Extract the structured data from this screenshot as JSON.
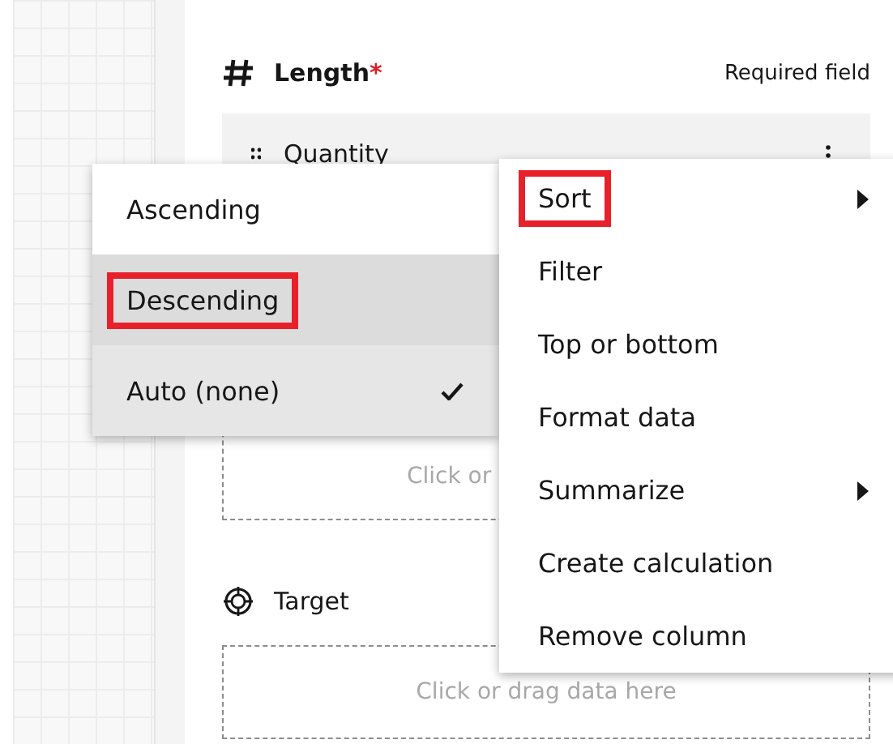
{
  "sections": [
    {
      "kind": "numeric",
      "label": "Length",
      "required": true,
      "required_mark": "*",
      "note": "Required field",
      "items": [
        {
          "label": "Quantity"
        }
      ],
      "drop_text": "Click or"
    },
    {
      "kind": "target",
      "label": "Target",
      "required": false,
      "drop_text": "Click or drag data here"
    }
  ],
  "context_menu": {
    "items": [
      {
        "label": "Sort",
        "submenu": true,
        "highlighted": true
      },
      {
        "label": "Filter",
        "submenu": false,
        "highlighted": false
      },
      {
        "label": "Top or bottom",
        "submenu": false,
        "highlighted": false
      },
      {
        "label": "Format data",
        "submenu": false,
        "highlighted": false
      },
      {
        "label": "Summarize",
        "submenu": true,
        "highlighted": false
      },
      {
        "label": "Create calculation",
        "submenu": false,
        "highlighted": false
      },
      {
        "label": "Remove column",
        "submenu": false,
        "highlighted": false
      }
    ]
  },
  "sort_submenu": {
    "items": [
      {
        "label": "Ascending",
        "selected": false,
        "hovered": false,
        "highlighted": false
      },
      {
        "label": "Descending",
        "selected": false,
        "hovered": true,
        "highlighted": true
      },
      {
        "label": "Auto (none)",
        "selected": true,
        "hovered": false,
        "highlighted": false
      }
    ]
  }
}
